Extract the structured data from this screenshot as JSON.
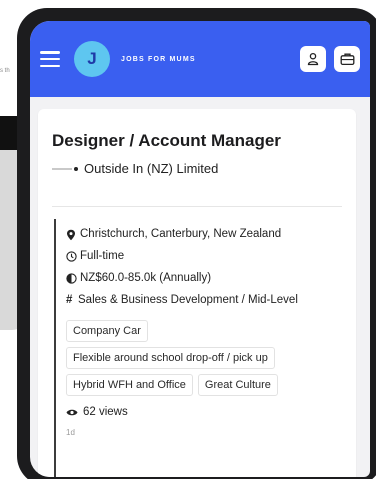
{
  "backdrop": {
    "snippet": "s th"
  },
  "header": {
    "logo_letter": "J",
    "brand": "JOBS FOR MUMS",
    "icons": [
      "menu-icon",
      "user-icon",
      "briefcase-icon"
    ]
  },
  "job": {
    "title": "Designer / Account Manager",
    "company": "Outside In (NZ) Limited",
    "location": "Christchurch, Canterbury, New Zealand",
    "type": "Full-time",
    "salary": "NZ$60.0-85.0k (Annually)",
    "category": "Sales & Business Development / Mid-Level",
    "tags": [
      "Company Car",
      "Flexible around school drop-off / pick up",
      "Hybrid WFH and Office",
      "Great Culture"
    ],
    "views": "62 views",
    "age": "1d"
  },
  "colors": {
    "header_bg": "#3a5ff0",
    "logo_bg": "#5ec6f0"
  }
}
